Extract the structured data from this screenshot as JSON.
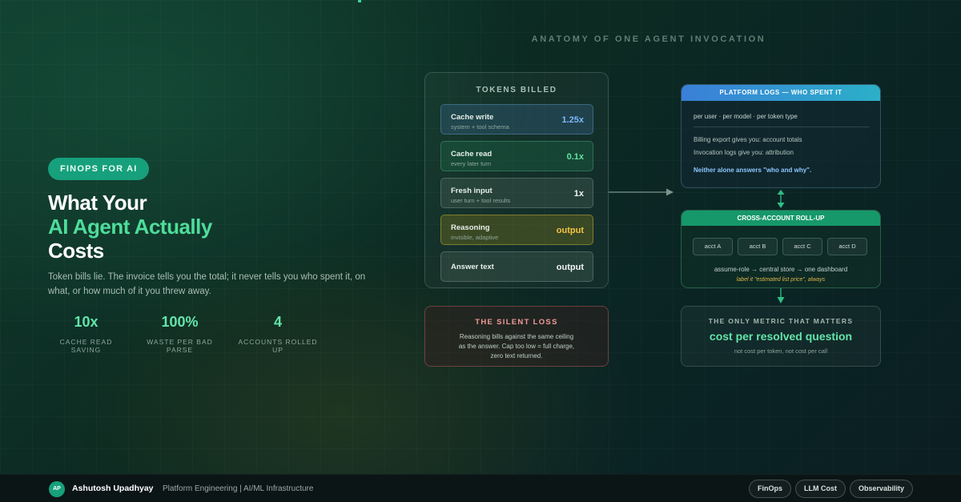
{
  "left": {
    "badge": "FINOPS FOR AI",
    "headline_line1": "What Your",
    "headline_accent": "AI Agent Actually",
    "headline_line3": "Costs",
    "lead": "Token bills lie. The invoice tells you the total; it never tells you who spent it, on what, or how much of it you threw away.",
    "stats": [
      {
        "value": "10x",
        "label": "CACHE READ SAVING"
      },
      {
        "value": "100%",
        "label": "WASTE PER BAD PARSE"
      },
      {
        "value": "4",
        "label": "ACCOUNTS ROLLED UP"
      }
    ]
  },
  "diagram": {
    "title": "ANATOMY OF ONE AGENT INVOCATION",
    "tokens_billed": {
      "title": "TOKENS BILLED",
      "rows": [
        {
          "name": "Cache write",
          "sub": "system + tool schema",
          "multiplier": "1.25x"
        },
        {
          "name": "Cache read",
          "sub": "every later turn",
          "multiplier": "0.1x"
        },
        {
          "name": "Fresh input",
          "sub": "user turn + tool results",
          "multiplier": "1x"
        },
        {
          "name": "Reasoning",
          "sub": "invisible, adaptive",
          "multiplier": "output"
        },
        {
          "name": "Answer text",
          "sub": "",
          "multiplier": "output"
        }
      ]
    },
    "silent_loss": {
      "title": "THE SILENT LOSS",
      "body": "Reasoning bills against the same ceiling as the answer. Cap too low = full charge, zero text returned."
    },
    "platform_logs": {
      "title": "PLATFORM LOGS — WHO SPENT IT",
      "dimensions": "per user · per model · per token type",
      "billing_line": "Billing export gives you: account totals",
      "invocation_line": "Invocation logs give you: attribution",
      "conclusion": "Neither alone answers \"who and why\"."
    },
    "rollup": {
      "title": "CROSS-ACCOUNT ROLL-UP",
      "accounts": [
        "acct A",
        "acct B",
        "acct C",
        "acct D"
      ],
      "flow": "assume-role → central store → one dashboard",
      "note": "label it \"estimated list price\", always"
    },
    "metric": {
      "kicker": "THE ONLY METRIC THAT MATTERS",
      "main": "cost per resolved question",
      "sub": "not cost per token, not cost per call"
    }
  },
  "footer": {
    "initials": "AP",
    "author": "Ashutosh Upadhyay",
    "role": "Platform Engineering | AI/ML Infrastructure",
    "tags": [
      "FinOps",
      "LLM Cost",
      "Observability"
    ]
  },
  "colors": {
    "accent_green": "#4fdc9b",
    "badge_green": "#17a07c",
    "cache_write_blue": "#7cb9ff",
    "reasoning_yellow": "#f4c542",
    "loss_red": "#f29a9a"
  }
}
